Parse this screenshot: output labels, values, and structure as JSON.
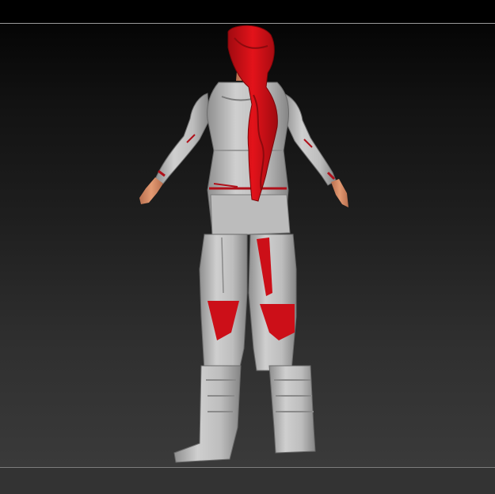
{
  "canvas": {
    "colors": {
      "background_top": "#050505",
      "background_bottom": "#3a3a3a",
      "frame_line": "#9a9a9a",
      "bottom_bar": "#333333"
    }
  },
  "model": {
    "colors": {
      "armor": "#bfbfbf",
      "armor_shadow": "#8a8a8a",
      "accent": "#cc0f18",
      "hair": "#d60f14",
      "skin": "#d98a62"
    }
  }
}
